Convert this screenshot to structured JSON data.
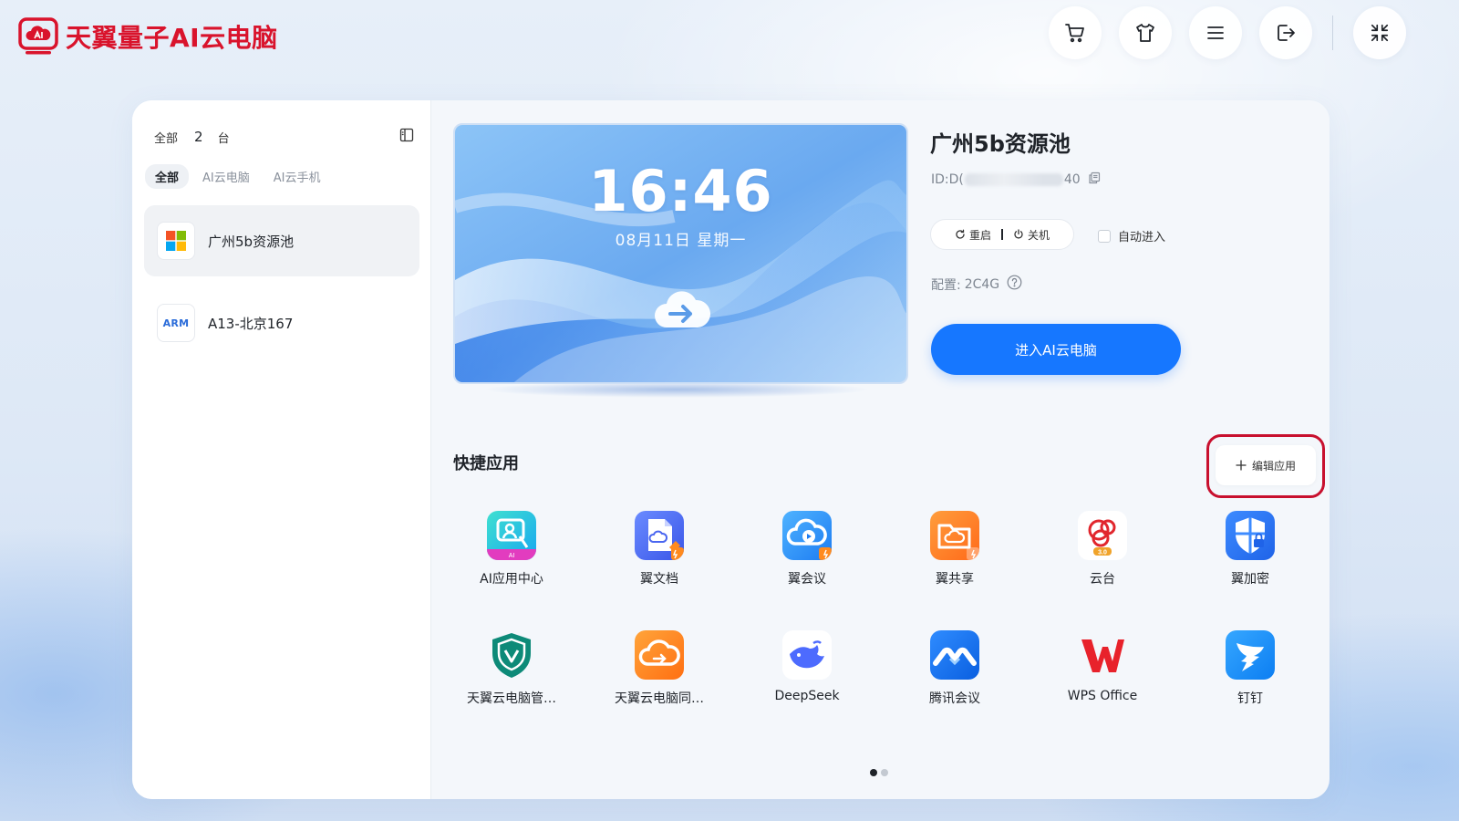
{
  "header": {
    "brand": "天翼量子AI云电脑",
    "brand_color": "#d9132c",
    "actions": [
      {
        "name": "cart-icon"
      },
      {
        "name": "tshirt-icon"
      },
      {
        "name": "menu-icon"
      },
      {
        "name": "logout-icon"
      },
      {
        "name": "shrink-icon"
      }
    ]
  },
  "sidebar": {
    "all_label": "全部",
    "count": "2",
    "unit": "台",
    "filters": [
      "全部",
      "AI云电脑",
      "AI云手机"
    ],
    "devices": [
      {
        "name": "广州5b资源池",
        "os": "windows-icon",
        "selected": true
      },
      {
        "name": "A13-北京167",
        "os_label": "ARM",
        "selected": false
      }
    ]
  },
  "preview": {
    "time": "16:46",
    "date": "08月11日 星期一"
  },
  "device": {
    "title": "广州5b资源池",
    "id_label": "ID: ",
    "id_prefix": "D(",
    "id_suffix": "40",
    "restart_label": "重启",
    "shutdown_label": "关机",
    "auto_enter_label": "自动进入",
    "auto_enter_checked": false,
    "config_label": "配置:",
    "config_value": "2C4G",
    "enter_label": "进入AI云电脑",
    "accent": "#1677ff"
  },
  "quick_apps": {
    "title": "快捷应用",
    "edit_label": "编辑应用",
    "apps": [
      {
        "label": "AI应用中心",
        "icon": "ai-app-center-icon"
      },
      {
        "label": "翼文档",
        "icon": "yi-doc-icon"
      },
      {
        "label": "翼会议",
        "icon": "yi-meeting-icon"
      },
      {
        "label": "翼共享",
        "icon": "yi-share-icon"
      },
      {
        "label": "云台",
        "icon": "yuntai-icon"
      },
      {
        "label": "翼加密",
        "icon": "yi-encrypt-icon"
      },
      {
        "label": "天翼云电脑管…",
        "icon": "shield-manager-icon"
      },
      {
        "label": "天翼云电脑同…",
        "icon": "cloud-sync-icon"
      },
      {
        "label": "DeepSeek",
        "icon": "deepseek-whale-icon"
      },
      {
        "label": "腾讯会议",
        "icon": "tencent-meeting-icon"
      },
      {
        "label": "WPS Office",
        "icon": "wps-icon"
      },
      {
        "label": "钉钉",
        "icon": "dingtalk-icon"
      }
    ],
    "page_count": 2,
    "current_page": 1
  }
}
